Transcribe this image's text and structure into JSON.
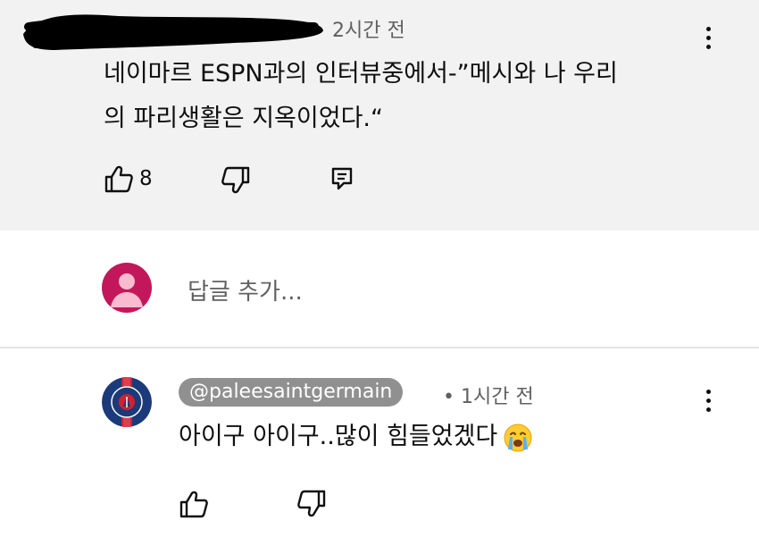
{
  "top_comment": {
    "time": "2시간 전",
    "text_line1": "네이마르 ESPN과의 인터뷰중에서-”메시와 나  우리",
    "text_line2": "의 파리생활은 지옥이었다.“",
    "like_count": "8",
    "icons": [
      "thumbs-up-icon",
      "thumbs-down-icon",
      "reply-icon",
      "more-vert-icon"
    ]
  },
  "reply_box": {
    "placeholder": "답글 추가..."
  },
  "reply": {
    "handle": "@paleesaintgermain",
    "time": "• 1시간 전",
    "text": "아이구 아이구..많이 힘들었겠다",
    "emoji": "crying-face-icon",
    "icons": [
      "thumbs-up-icon",
      "thumbs-down-icon",
      "more-vert-icon"
    ]
  },
  "colors": {
    "top_bg": "#f2f2f2",
    "avatar_me": "#c2185b",
    "handle_pill": "#909090",
    "psg_blue": "#1b3a7a",
    "psg_red": "#d2202e"
  }
}
